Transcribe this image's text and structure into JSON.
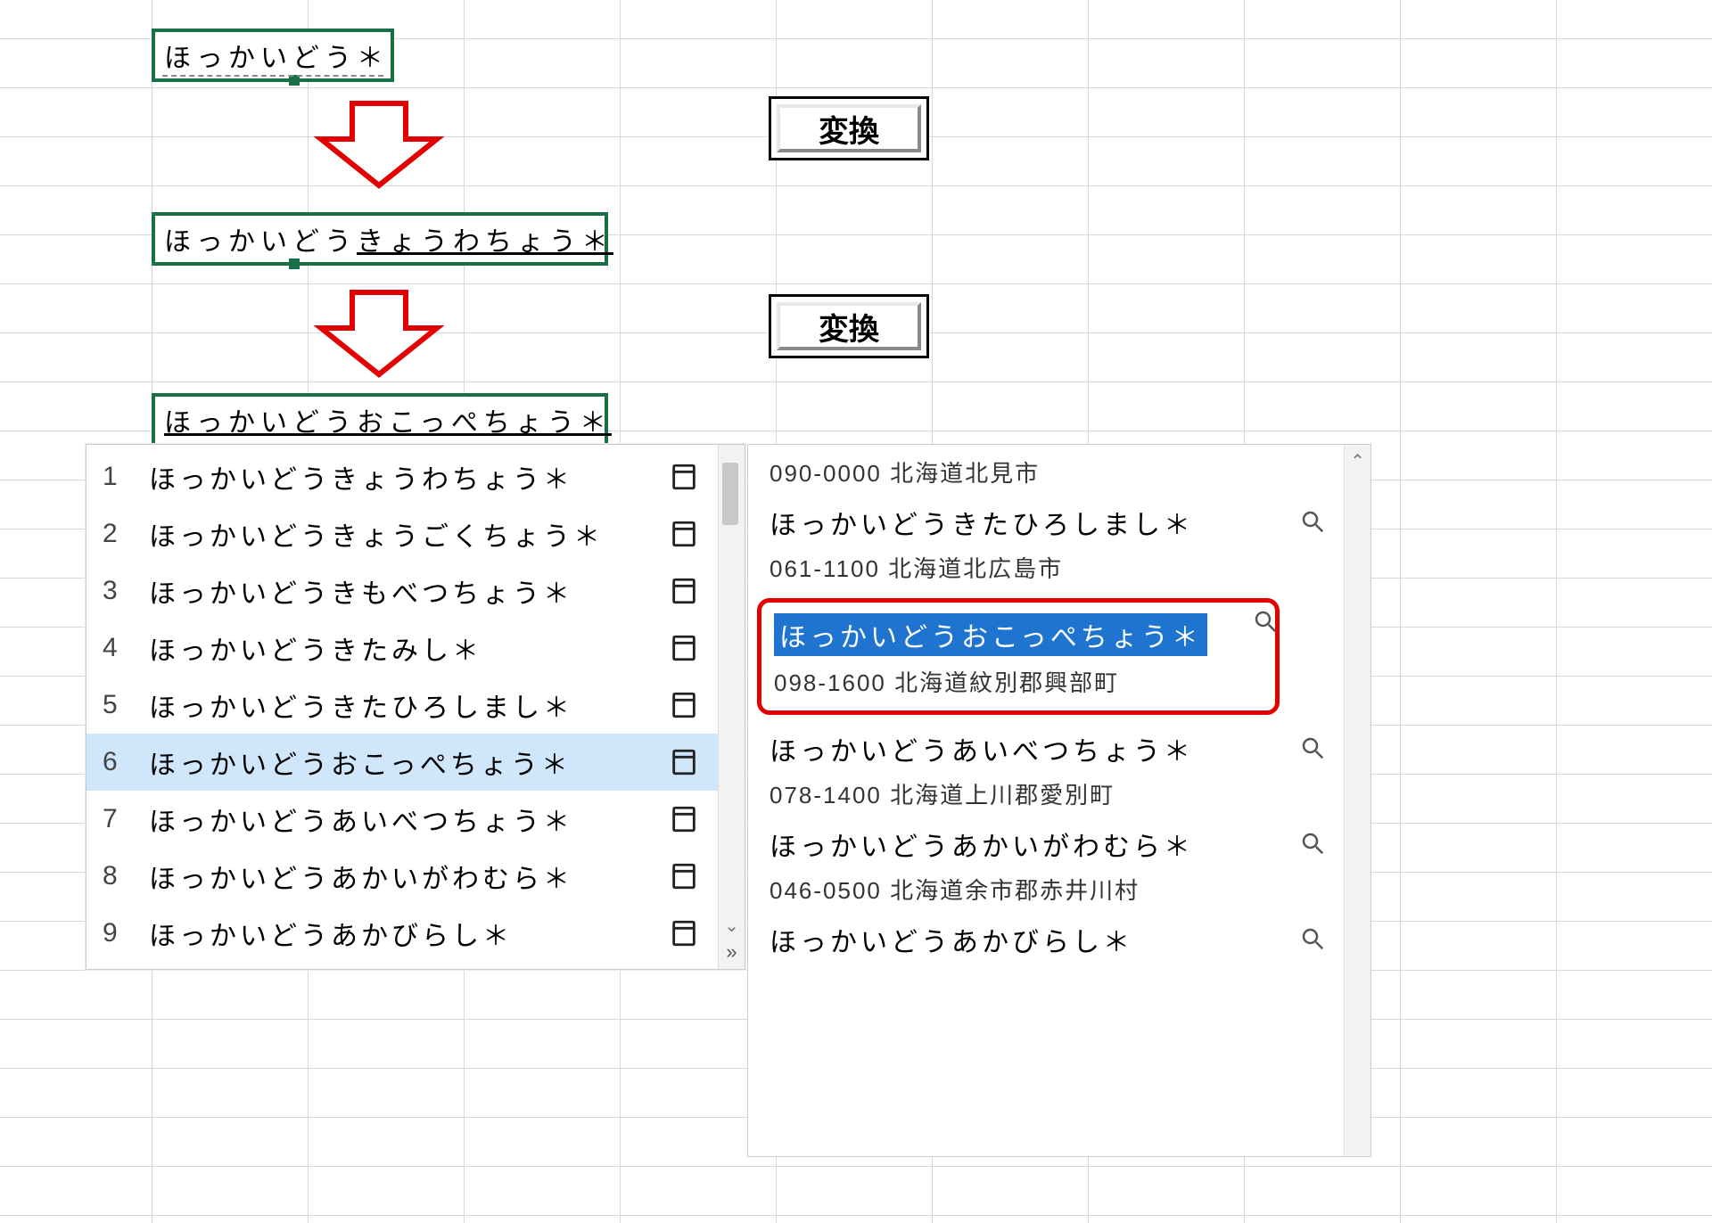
{
  "cells": {
    "c1": "ほっかいどう＊",
    "c2_plain": "ほっかいどう",
    "c2_under": "きょうわちょう＊",
    "c3": "ほっかいどうおこっぺちょう＊"
  },
  "keys": {
    "henkan": "変換"
  },
  "candidates": [
    {
      "n": "1",
      "t": "ほっかいどうきょうわちょう＊"
    },
    {
      "n": "2",
      "t": "ほっかいどうきょうごくちょう＊"
    },
    {
      "n": "3",
      "t": "ほっかいどうきもべつちょう＊"
    },
    {
      "n": "4",
      "t": "ほっかいどうきたみし＊"
    },
    {
      "n": "5",
      "t": "ほっかいどうきたひろしまし＊"
    },
    {
      "n": "6",
      "t": "ほっかいどうおこっぺちょう＊"
    },
    {
      "n": "7",
      "t": "ほっかいどうあいべつちょう＊"
    },
    {
      "n": "8",
      "t": "ほっかいどうあかいがわむら＊"
    },
    {
      "n": "9",
      "t": "ほっかいどうあかびらし＊"
    }
  ],
  "selected_index": 5,
  "details": [
    {
      "reading": "",
      "addr": "090-0000 北海道北見市",
      "top": true
    },
    {
      "reading": "ほっかいどうきたひろしまし＊",
      "addr": "061-1100 北海道北広島市"
    },
    {
      "reading": "ほっかいどうおこっぺちょう＊",
      "addr": "098-1600 北海道紋別郡興部町",
      "hl": true
    },
    {
      "reading": "ほっかいどうあいべつちょう＊",
      "addr": "078-1400 北海道上川郡愛別町"
    },
    {
      "reading": "ほっかいどうあかいがわむら＊",
      "addr": "046-0500 北海道余市郡赤井川村"
    },
    {
      "reading": "ほっかいどうあかびらし＊",
      "addr": ""
    }
  ]
}
